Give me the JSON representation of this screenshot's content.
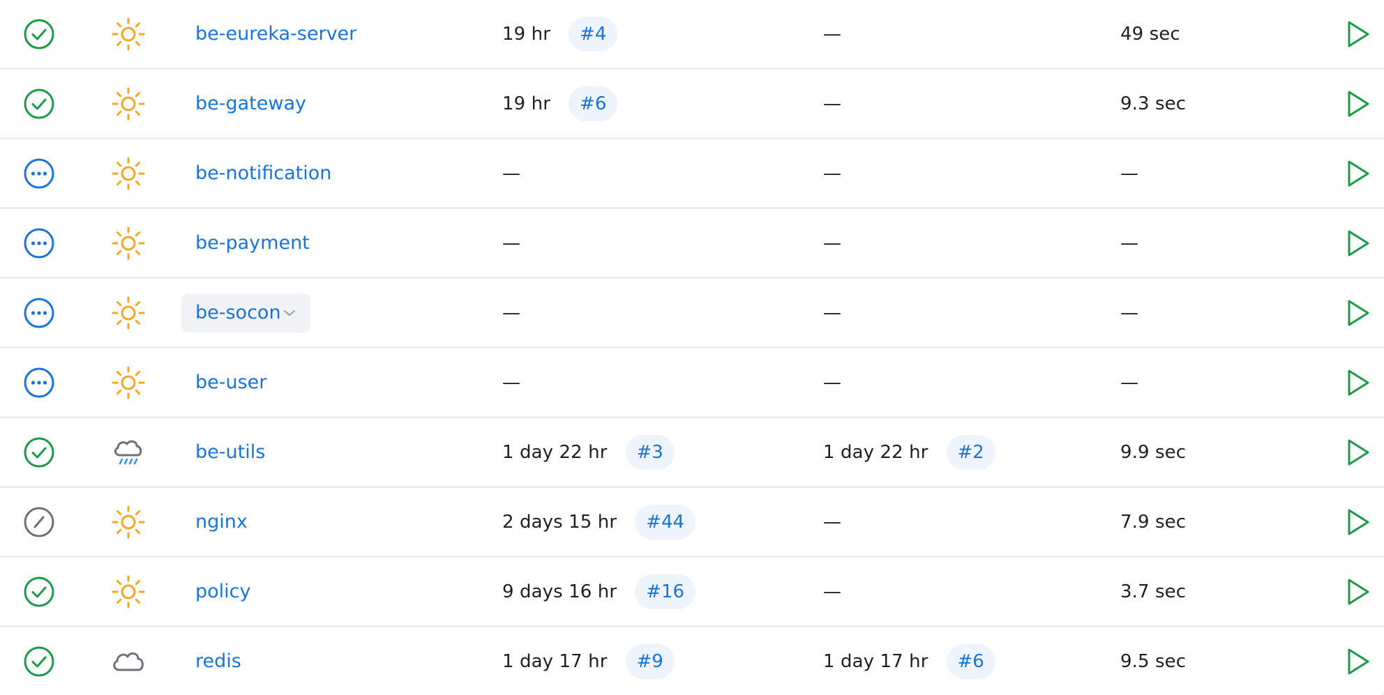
{
  "colors": {
    "success": "#1a9a46",
    "running": "#1a73d9",
    "disabled": "#6f6f7a",
    "sun": "#f5a623",
    "rain": "#3a8ee6",
    "link": "#1a73d9",
    "run": "#1a9a46"
  },
  "jobs": [
    {
      "status_icon": "success-check-icon",
      "weather_icon": "sunny-icon",
      "name": "be-eureka-server",
      "last_success": "19 hr",
      "last_success_build": "#4",
      "last_failure": "—",
      "last_failure_build": "",
      "last_duration": "49 sec"
    },
    {
      "status_icon": "success-check-icon",
      "weather_icon": "sunny-icon",
      "name": "be-gateway",
      "last_success": "19 hr",
      "last_success_build": "#6",
      "last_failure": "—",
      "last_failure_build": "",
      "last_duration": "9.3 sec"
    },
    {
      "status_icon": "not-built-icon",
      "weather_icon": "sunny-icon",
      "name": "be-notification",
      "last_success": "—",
      "last_success_build": "",
      "last_failure": "—",
      "last_failure_build": "",
      "last_duration": "—"
    },
    {
      "status_icon": "not-built-icon",
      "weather_icon": "sunny-icon",
      "name": "be-payment",
      "last_success": "—",
      "last_success_build": "",
      "last_failure": "—",
      "last_failure_build": "",
      "last_duration": "—"
    },
    {
      "status_icon": "not-built-icon",
      "weather_icon": "sunny-icon",
      "name": "be-socon",
      "last_success": "—",
      "last_success_build": "",
      "last_failure": "—",
      "last_failure_build": "",
      "last_duration": "—"
    },
    {
      "status_icon": "not-built-icon",
      "weather_icon": "sunny-icon",
      "name": "be-user",
      "last_success": "—",
      "last_success_build": "",
      "last_failure": "—",
      "last_failure_build": "",
      "last_duration": "—"
    },
    {
      "status_icon": "success-check-icon",
      "weather_icon": "rainy-icon",
      "name": "be-utils",
      "last_success": "1 day 22 hr",
      "last_success_build": "#3",
      "last_failure": "1 day 22 hr",
      "last_failure_build": "#2",
      "last_duration": "9.9 sec"
    },
    {
      "status_icon": "disabled-icon",
      "weather_icon": "sunny-icon",
      "name": "nginx",
      "last_success": "2 days 15 hr",
      "last_success_build": "#44",
      "last_failure": "—",
      "last_failure_build": "",
      "last_duration": "7.9 sec"
    },
    {
      "status_icon": "success-check-icon",
      "weather_icon": "sunny-icon",
      "name": "policy",
      "last_success": "9 days 16 hr",
      "last_success_build": "#16",
      "last_failure": "—",
      "last_failure_build": "",
      "last_duration": "3.7 sec"
    },
    {
      "status_icon": "success-check-icon",
      "weather_icon": "cloudy-icon",
      "name": "redis",
      "last_success": "1 day 17 hr",
      "last_success_build": "#9",
      "last_failure": "1 day 17 hr",
      "last_failure_build": "#6",
      "last_duration": "9.5 sec"
    }
  ]
}
